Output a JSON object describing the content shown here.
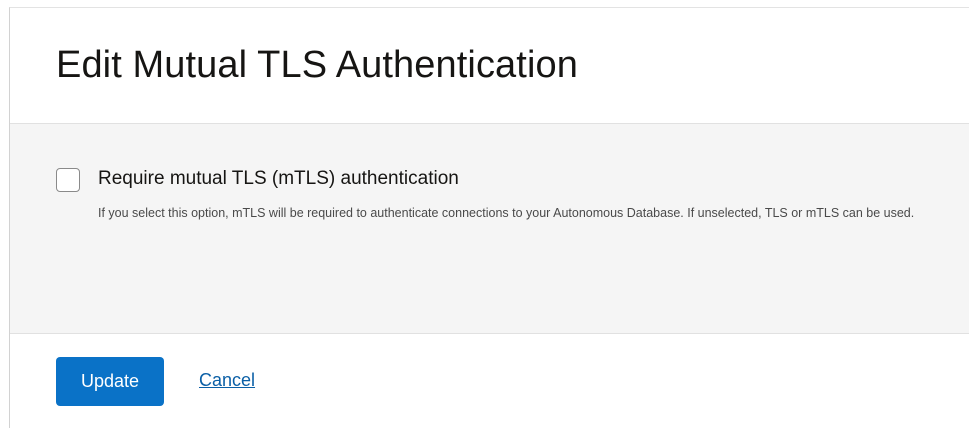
{
  "dialog": {
    "title": "Edit Mutual TLS Authentication"
  },
  "option": {
    "checked": false,
    "label": "Require mutual TLS (mTLS) authentication",
    "help_text": "If you select this option, mTLS will be required to authenticate connections to your Autonomous Database. If unselected, TLS or mTLS can be used."
  },
  "footer": {
    "update_label": "Update",
    "cancel_label": "Cancel"
  },
  "colors": {
    "primary_button": "#0a72c7",
    "link": "#0a5fa6",
    "body_background": "#f5f5f5"
  }
}
